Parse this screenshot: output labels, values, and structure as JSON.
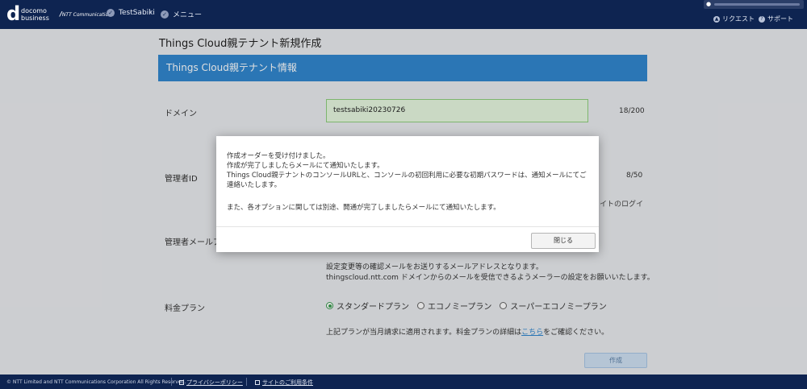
{
  "header": {
    "logo_mark": "d",
    "logo_line1": "docomo",
    "logo_line2": "business",
    "ntt_brand": "NTT Communications",
    "breadcrumb": [
      "TestSabiki",
      "メニュー"
    ],
    "links": [
      {
        "label": "リクエスト",
        "icon": "bell-icon"
      },
      {
        "label": "サポート",
        "icon": "help-icon"
      }
    ],
    "user_icon": "user-icon"
  },
  "page": {
    "title": "Things Cloud親テナント新規作成",
    "panel_title": "Things Cloud親テナント情報",
    "fields": {
      "domain": {
        "label": "ドメイン",
        "value": "testsabiki20230726",
        "counter": "18/200"
      },
      "admin_id": {
        "label": "管理者ID",
        "counter": "8/50",
        "side_text": "イトのログイ"
      },
      "admin_email": {
        "label": "管理者メールア"
      }
    },
    "email_hint_1": "設定変更等の確認メールをお送りするメールアドレスとなります。",
    "email_hint_2": "thingscloud.ntt.com ドメインからのメールを受信できるようメーラーの設定をお願いいたします。",
    "plan": {
      "label": "料金プラン",
      "options": [
        "スタンダードプラン",
        "エコノミープラン",
        "スーパーエコノミープラン"
      ],
      "selected": "スタンダードプラン",
      "note_before": "上記プランが当月請求に適用されます。料金プランの詳細は",
      "note_link": "こちら",
      "note_after": "をご確認ください。"
    },
    "create_button": "作成"
  },
  "modal": {
    "line1": "作成オーダーを受け付けました。",
    "line2": "作成が完了しましたらメールにて通知いたします。",
    "line3": "Things Cloud親テナントのコンソールURLと、コンソールの初回利用に必要な初期パスワードは、通知メールにてご",
    "line4": "連絡いたします。",
    "line5": "また、各オプションに関しては別途、開通が完了しましたらメールにて通知いたします。",
    "close_button": "閉じる"
  },
  "footer": {
    "copyright": "© NTT Limited and NTT Communications Corporation All Rights Reserved.",
    "links": [
      "プライバシーポリシー",
      "サイトのご利用条件"
    ]
  },
  "colors": {
    "header_bg": "#0e2451",
    "panel_accent": "#3187cf",
    "input_valid_bg": "#e6f7e0",
    "radio_selected": "#3a9a4f"
  }
}
